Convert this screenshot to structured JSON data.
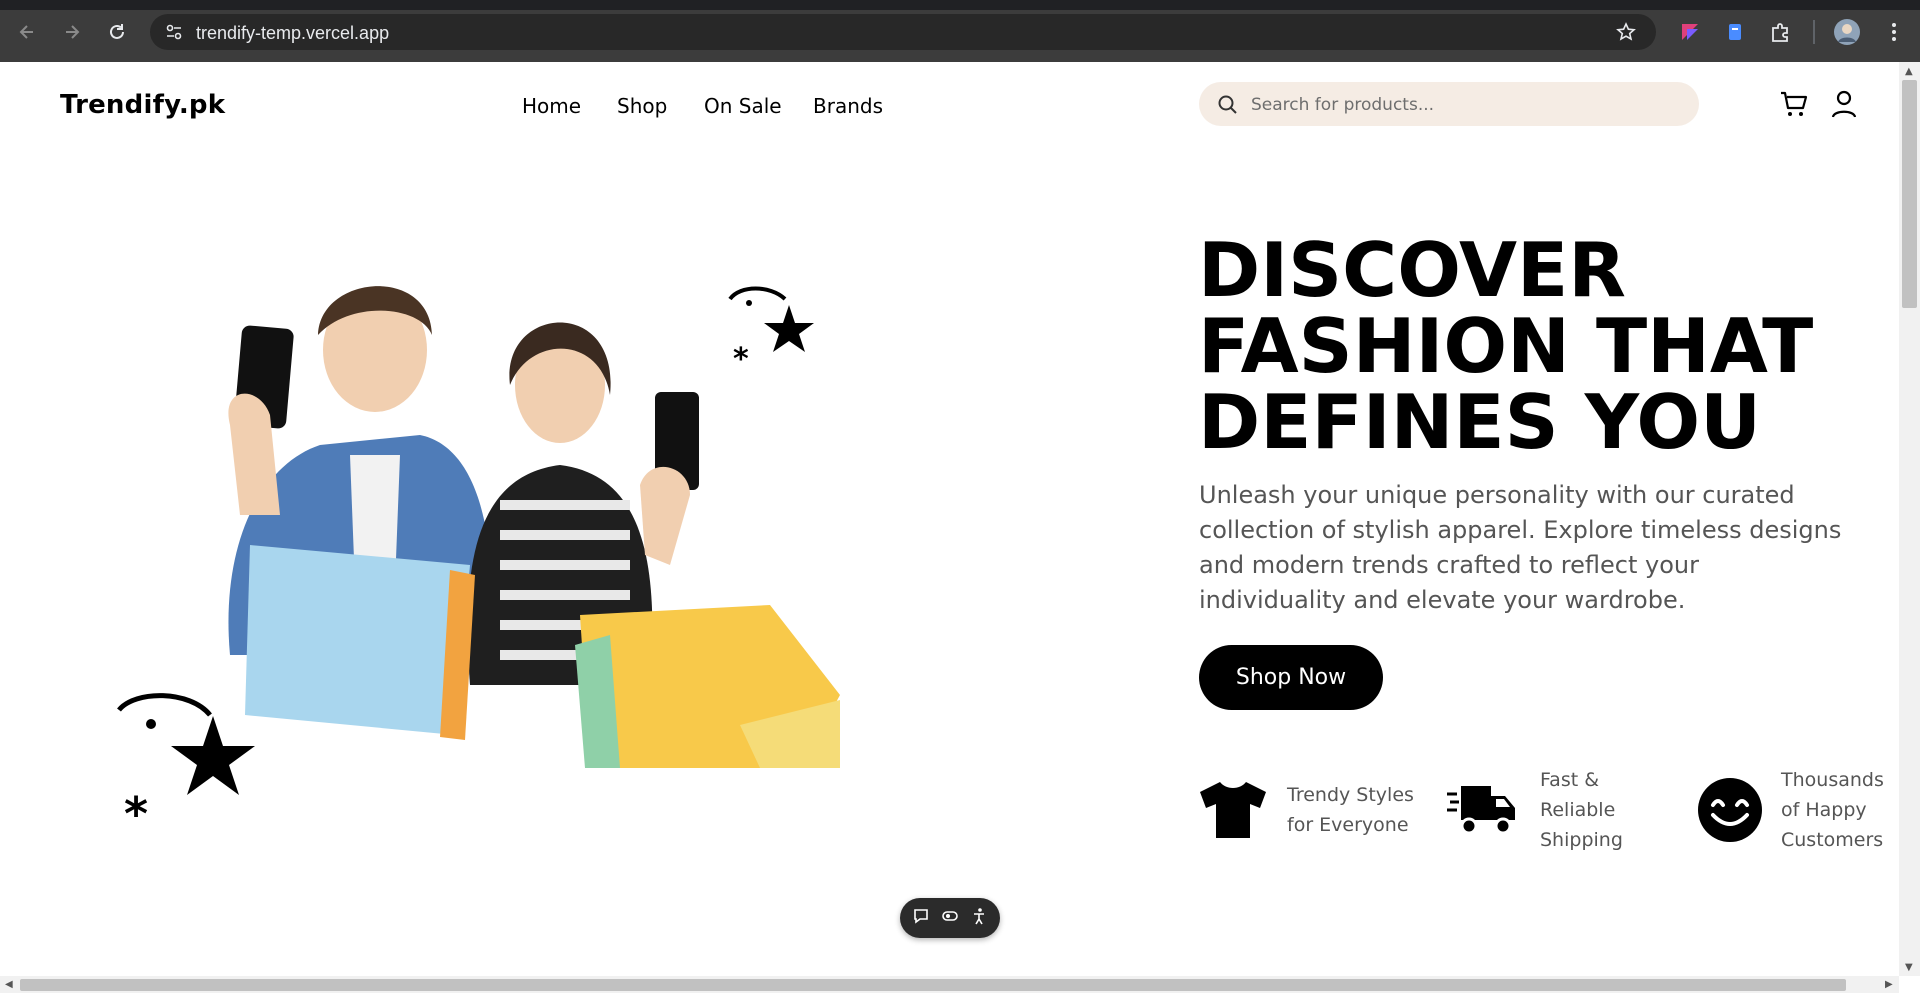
{
  "browser": {
    "url": "trendify-temp.vercel.app",
    "icons": [
      "back-icon",
      "forward-icon",
      "reload-icon",
      "site-info-icon",
      "bookmark-star-icon",
      "extension-color-icon",
      "extension-doc-icon",
      "extensions-puzzle-icon",
      "profile-avatar-icon",
      "more-menu-icon"
    ]
  },
  "header": {
    "logo": "Trendify.pk",
    "nav": [
      "Home",
      "Shop",
      "On Sale",
      "Brands"
    ],
    "search_placeholder": "Search for products...",
    "icons": [
      "search-icon",
      "cart-icon",
      "user-icon"
    ]
  },
  "hero": {
    "heading_lines": [
      "DISCOVER",
      "FASHION THAT",
      "DEFINES YOU"
    ],
    "description": "Unleash your unique personality with our curated collection of stylish apparel. Explore timeless designs and modern trends crafted to reflect your individuality and elevate your wardrobe.",
    "cta": "Shop Now",
    "features": [
      {
        "icon": "tshirt-icon",
        "text": "Trendy Styles for Everyone"
      },
      {
        "icon": "delivery-truck-icon",
        "text": "Fast & Reliable Shipping"
      },
      {
        "icon": "smiley-icon",
        "text": "Thousands of Happy Customers"
      }
    ]
  },
  "widget": {
    "icons": [
      "chat-icon",
      "toggle-icon",
      "accessibility-icon"
    ]
  },
  "colors": {
    "search_bg": "#f5ece4",
    "button_bg": "#000000",
    "chrome_bg": "#3c3c3c"
  }
}
